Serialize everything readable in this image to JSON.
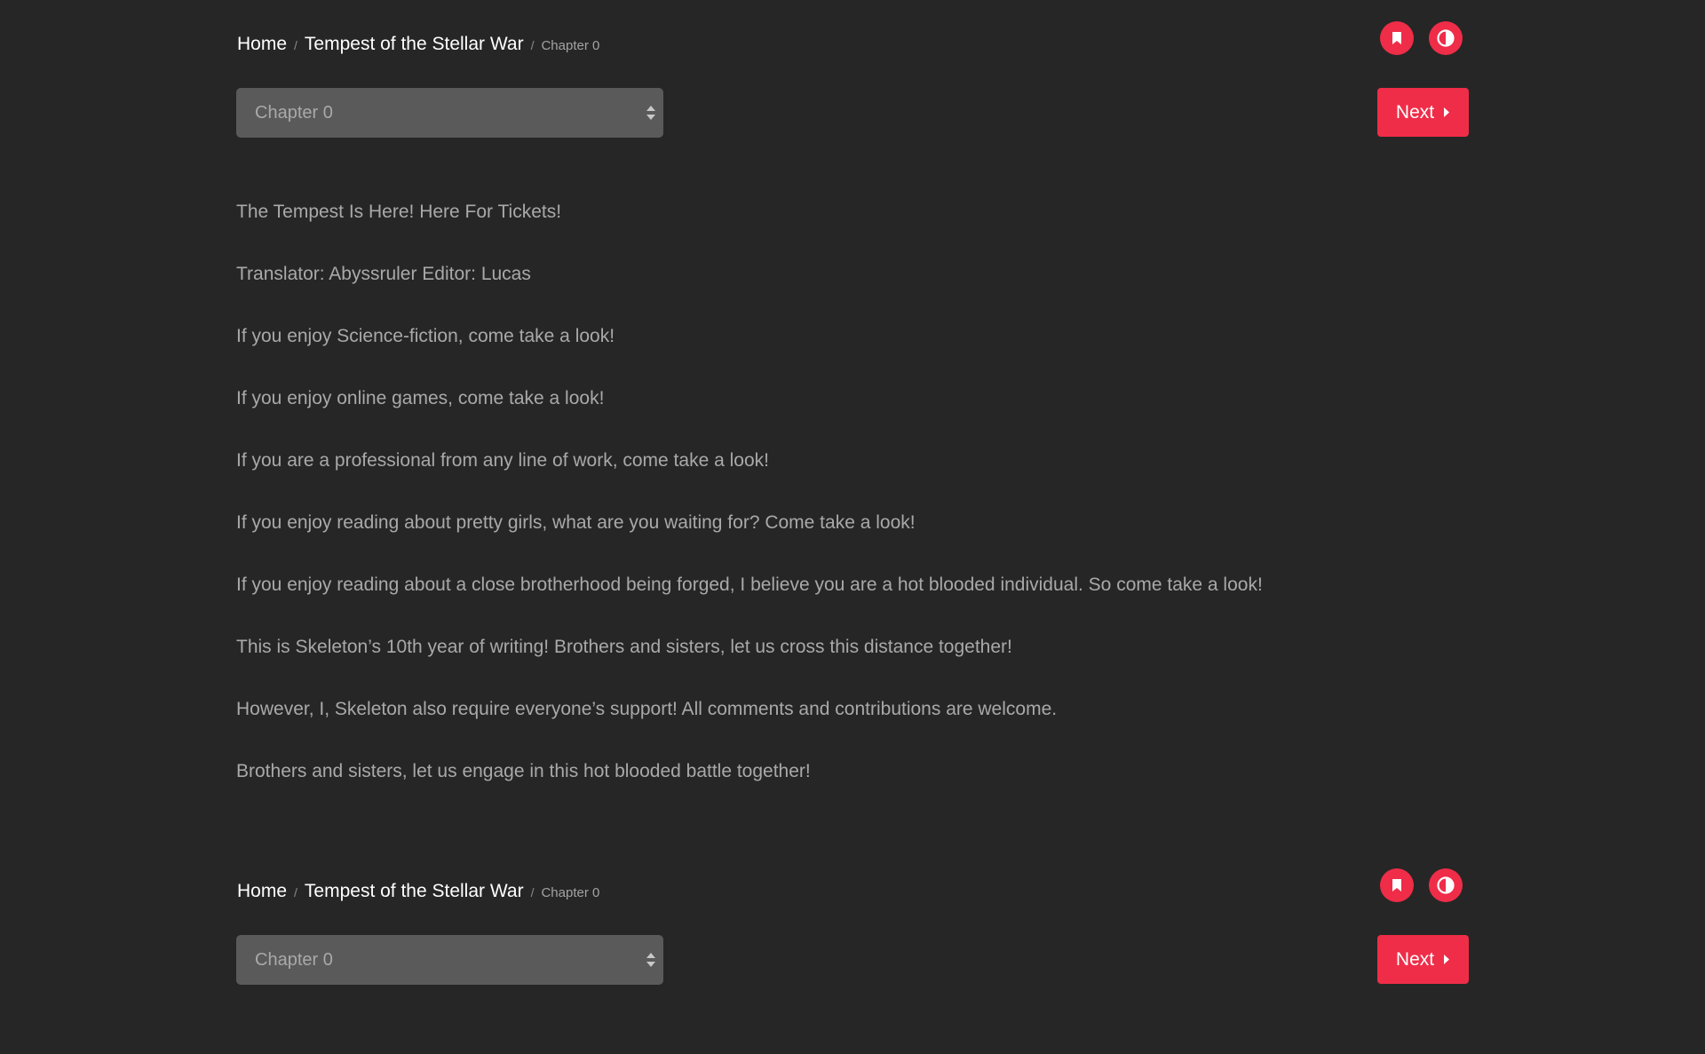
{
  "nav": {
    "home_label": "Home",
    "novel_title": "Tempest of the Stellar War",
    "separator": "/",
    "current_chapter": "Chapter 0",
    "select_value": "Chapter 0",
    "next_label": "Next",
    "accent_color": "#ef2d48",
    "icons": {
      "bookmark": "bookmark-icon",
      "contrast": "contrast-icon",
      "next": "caret-right-icon",
      "select": "sort-arrows-icon"
    }
  },
  "content": {
    "paragraphs": [
      "The Tempest Is Here! Here For Tickets!",
      "Translator: Abyssruler Editor: Lucas",
      "If you enjoy Science-fiction, come take a look!",
      "If you enjoy online games, come take a look!",
      "If you are a professional from any line of work, come take a look!",
      "If you enjoy reading about pretty girls, what are you waiting for? Come take a look!",
      "If you enjoy reading about a close brotherhood being forged, I believe you are a hot blooded individual. So come take a look!",
      "This is Skeleton’s 10th year of writing! Brothers and sisters, let us cross this distance together!",
      "However, I, Skeleton also require everyone’s support! All comments and contributions are welcome.",
      "Brothers and sisters, let us engage in this hot blooded battle together!"
    ]
  },
  "theme": {
    "background": "#262626",
    "text": "#a9a9a9",
    "select_background": "#5a5a5a"
  }
}
